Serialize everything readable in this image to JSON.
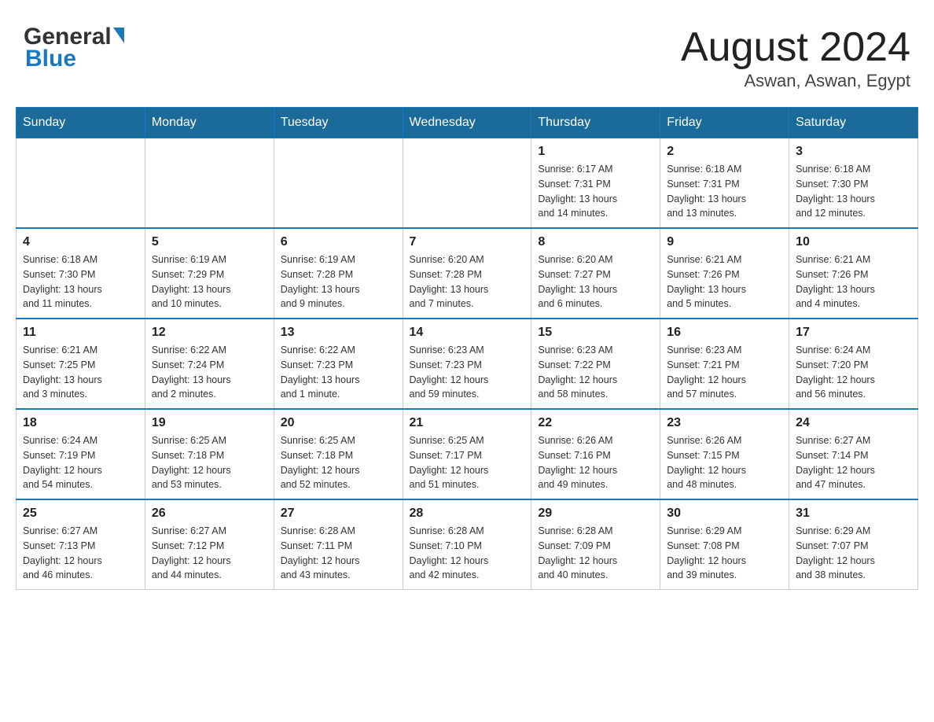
{
  "header": {
    "logo_general": "General",
    "logo_blue": "Blue",
    "title": "August 2024",
    "subtitle": "Aswan, Aswan, Egypt"
  },
  "days_of_week": [
    "Sunday",
    "Monday",
    "Tuesday",
    "Wednesday",
    "Thursday",
    "Friday",
    "Saturday"
  ],
  "weeks": [
    [
      {
        "day": "",
        "info": ""
      },
      {
        "day": "",
        "info": ""
      },
      {
        "day": "",
        "info": ""
      },
      {
        "day": "",
        "info": ""
      },
      {
        "day": "1",
        "info": "Sunrise: 6:17 AM\nSunset: 7:31 PM\nDaylight: 13 hours\nand 14 minutes."
      },
      {
        "day": "2",
        "info": "Sunrise: 6:18 AM\nSunset: 7:31 PM\nDaylight: 13 hours\nand 13 minutes."
      },
      {
        "day": "3",
        "info": "Sunrise: 6:18 AM\nSunset: 7:30 PM\nDaylight: 13 hours\nand 12 minutes."
      }
    ],
    [
      {
        "day": "4",
        "info": "Sunrise: 6:18 AM\nSunset: 7:30 PM\nDaylight: 13 hours\nand 11 minutes."
      },
      {
        "day": "5",
        "info": "Sunrise: 6:19 AM\nSunset: 7:29 PM\nDaylight: 13 hours\nand 10 minutes."
      },
      {
        "day": "6",
        "info": "Sunrise: 6:19 AM\nSunset: 7:28 PM\nDaylight: 13 hours\nand 9 minutes."
      },
      {
        "day": "7",
        "info": "Sunrise: 6:20 AM\nSunset: 7:28 PM\nDaylight: 13 hours\nand 7 minutes."
      },
      {
        "day": "8",
        "info": "Sunrise: 6:20 AM\nSunset: 7:27 PM\nDaylight: 13 hours\nand 6 minutes."
      },
      {
        "day": "9",
        "info": "Sunrise: 6:21 AM\nSunset: 7:26 PM\nDaylight: 13 hours\nand 5 minutes."
      },
      {
        "day": "10",
        "info": "Sunrise: 6:21 AM\nSunset: 7:26 PM\nDaylight: 13 hours\nand 4 minutes."
      }
    ],
    [
      {
        "day": "11",
        "info": "Sunrise: 6:21 AM\nSunset: 7:25 PM\nDaylight: 13 hours\nand 3 minutes."
      },
      {
        "day": "12",
        "info": "Sunrise: 6:22 AM\nSunset: 7:24 PM\nDaylight: 13 hours\nand 2 minutes."
      },
      {
        "day": "13",
        "info": "Sunrise: 6:22 AM\nSunset: 7:23 PM\nDaylight: 13 hours\nand 1 minute."
      },
      {
        "day": "14",
        "info": "Sunrise: 6:23 AM\nSunset: 7:23 PM\nDaylight: 12 hours\nand 59 minutes."
      },
      {
        "day": "15",
        "info": "Sunrise: 6:23 AM\nSunset: 7:22 PM\nDaylight: 12 hours\nand 58 minutes."
      },
      {
        "day": "16",
        "info": "Sunrise: 6:23 AM\nSunset: 7:21 PM\nDaylight: 12 hours\nand 57 minutes."
      },
      {
        "day": "17",
        "info": "Sunrise: 6:24 AM\nSunset: 7:20 PM\nDaylight: 12 hours\nand 56 minutes."
      }
    ],
    [
      {
        "day": "18",
        "info": "Sunrise: 6:24 AM\nSunset: 7:19 PM\nDaylight: 12 hours\nand 54 minutes."
      },
      {
        "day": "19",
        "info": "Sunrise: 6:25 AM\nSunset: 7:18 PM\nDaylight: 12 hours\nand 53 minutes."
      },
      {
        "day": "20",
        "info": "Sunrise: 6:25 AM\nSunset: 7:18 PM\nDaylight: 12 hours\nand 52 minutes."
      },
      {
        "day": "21",
        "info": "Sunrise: 6:25 AM\nSunset: 7:17 PM\nDaylight: 12 hours\nand 51 minutes."
      },
      {
        "day": "22",
        "info": "Sunrise: 6:26 AM\nSunset: 7:16 PM\nDaylight: 12 hours\nand 49 minutes."
      },
      {
        "day": "23",
        "info": "Sunrise: 6:26 AM\nSunset: 7:15 PM\nDaylight: 12 hours\nand 48 minutes."
      },
      {
        "day": "24",
        "info": "Sunrise: 6:27 AM\nSunset: 7:14 PM\nDaylight: 12 hours\nand 47 minutes."
      }
    ],
    [
      {
        "day": "25",
        "info": "Sunrise: 6:27 AM\nSunset: 7:13 PM\nDaylight: 12 hours\nand 46 minutes."
      },
      {
        "day": "26",
        "info": "Sunrise: 6:27 AM\nSunset: 7:12 PM\nDaylight: 12 hours\nand 44 minutes."
      },
      {
        "day": "27",
        "info": "Sunrise: 6:28 AM\nSunset: 7:11 PM\nDaylight: 12 hours\nand 43 minutes."
      },
      {
        "day": "28",
        "info": "Sunrise: 6:28 AM\nSunset: 7:10 PM\nDaylight: 12 hours\nand 42 minutes."
      },
      {
        "day": "29",
        "info": "Sunrise: 6:28 AM\nSunset: 7:09 PM\nDaylight: 12 hours\nand 40 minutes."
      },
      {
        "day": "30",
        "info": "Sunrise: 6:29 AM\nSunset: 7:08 PM\nDaylight: 12 hours\nand 39 minutes."
      },
      {
        "day": "31",
        "info": "Sunrise: 6:29 AM\nSunset: 7:07 PM\nDaylight: 12 hours\nand 38 minutes."
      }
    ]
  ]
}
